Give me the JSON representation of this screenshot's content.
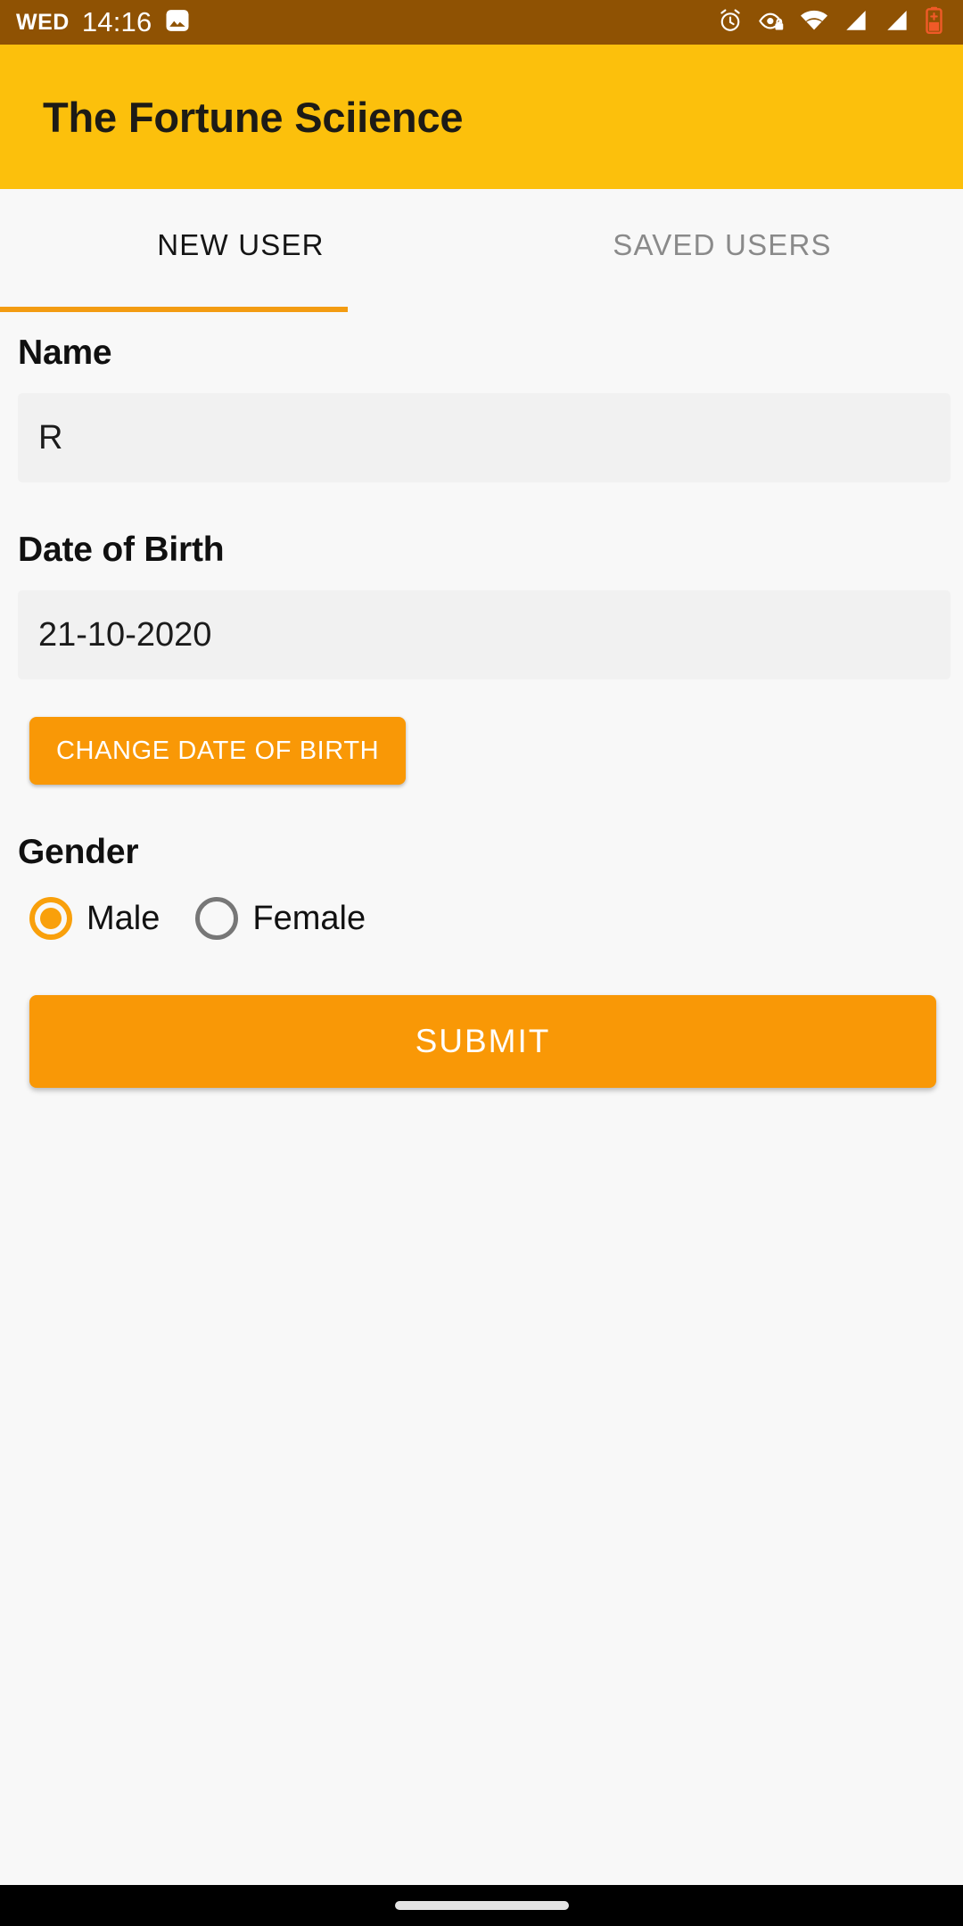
{
  "status_bar": {
    "day": "WED",
    "time": "14:16",
    "background_color": "#8F5203",
    "notification_icons": [
      {
        "name": "photo-icon",
        "label": "photo"
      }
    ],
    "system_icons": [
      {
        "name": "alarm-icon",
        "label": "alarm"
      },
      {
        "name": "eye-lock-icon",
        "label": "privacy"
      },
      {
        "name": "wifi-icon",
        "label": "wifi"
      },
      {
        "name": "signal-sim1-icon",
        "label": "signal 1"
      },
      {
        "name": "signal-sim2-icon",
        "label": "signal 2"
      },
      {
        "name": "battery-low-icon",
        "label": "battery low"
      }
    ]
  },
  "app_bar": {
    "title": "The Fortune Sciience",
    "background_color": "#FCC00C",
    "title_color": "#1D1B16"
  },
  "tabs": {
    "indicator_color": "#F39C12",
    "items": [
      {
        "label": "NEW USER",
        "active": true
      },
      {
        "label": "SAVED USERS",
        "active": false
      }
    ]
  },
  "form": {
    "name": {
      "label": "Name",
      "value": "R",
      "placeholder": "Name"
    },
    "date_of_birth": {
      "label": "Date of Birth",
      "value": "21-10-2020",
      "placeholder": "Date of Birth",
      "change_button_label": "CHANGE DATE OF BIRTH"
    },
    "gender": {
      "label": "Gender",
      "selected": "Male",
      "options": [
        {
          "label": "Male",
          "selected": true
        },
        {
          "label": "Female",
          "selected": false
        }
      ]
    },
    "submit_label": "SUBMIT",
    "accent_color": "#F99806"
  },
  "nav_bar": {
    "background_color": "#000000",
    "gesture_pill_color": "#E4E4E4"
  }
}
